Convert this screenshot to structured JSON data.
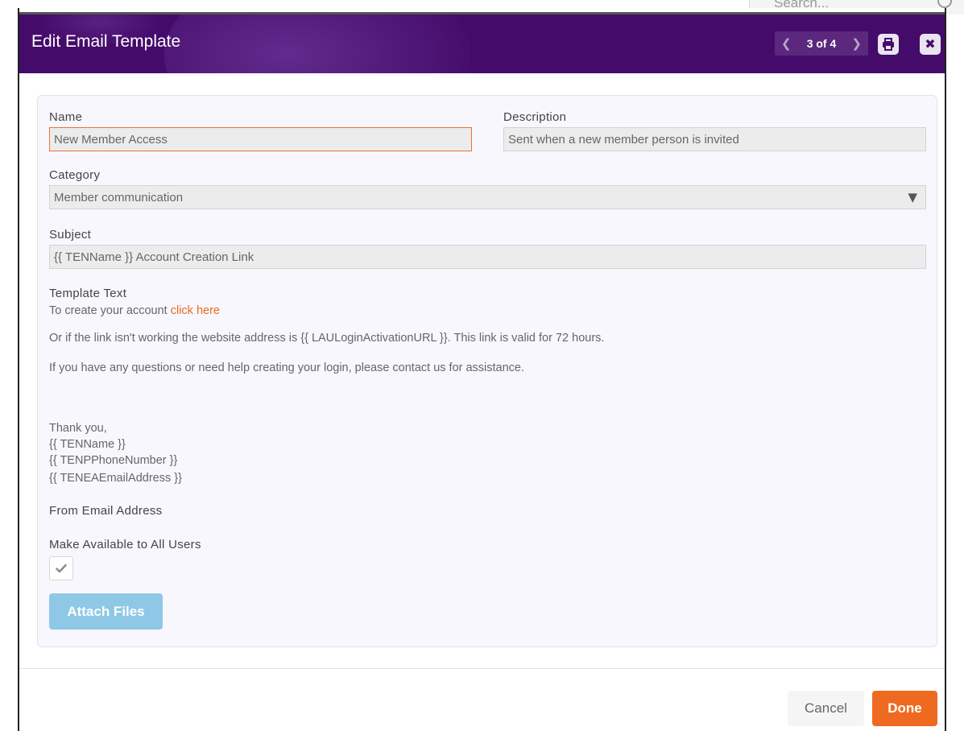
{
  "background": {
    "search_placeholder": "Search..."
  },
  "dialog": {
    "title": "Edit Email Template",
    "pager": {
      "text": "3 of 4",
      "prev_icon": "chevron-left-icon",
      "next_icon": "chevron-right-icon"
    },
    "print_icon": "print-icon",
    "close_icon": "close-icon"
  },
  "form": {
    "name": {
      "label": "Name",
      "value": "New Member Access"
    },
    "description": {
      "label": "Description",
      "value": "Sent when a new member person is invited"
    },
    "category": {
      "label": "Category",
      "value": "Member communication"
    },
    "subject": {
      "label": "Subject",
      "value": "{{ TENName }} Account Creation Link"
    },
    "template_text": {
      "label": "Template Text",
      "line1_prefix": "To create your account ",
      "line1_link": "click here",
      "line2": "Or if the link isn't working the website address is {{ LAULoginActivationURL }}. This link is valid for 72 hours.",
      "line3": "If you have any questions or need help creating your login, please contact us for assistance.",
      "signoff": "Thank you,",
      "sig_name": "{{ TENName }}",
      "sig_phone": "{{ TENPPhoneNumber }}",
      "sig_email": "{{ TENEAEmailAddress }}"
    },
    "from_email": {
      "label": "From Email Address"
    },
    "make_available": {
      "label": "Make Available to All Users",
      "checked": true
    },
    "attach_files_label": "Attach Files"
  },
  "footer": {
    "cancel_label": "Cancel",
    "done_label": "Done"
  },
  "colors": {
    "header": "#450b6b",
    "accent": "#ef6a21",
    "attach_button": "#8ec8e6"
  }
}
